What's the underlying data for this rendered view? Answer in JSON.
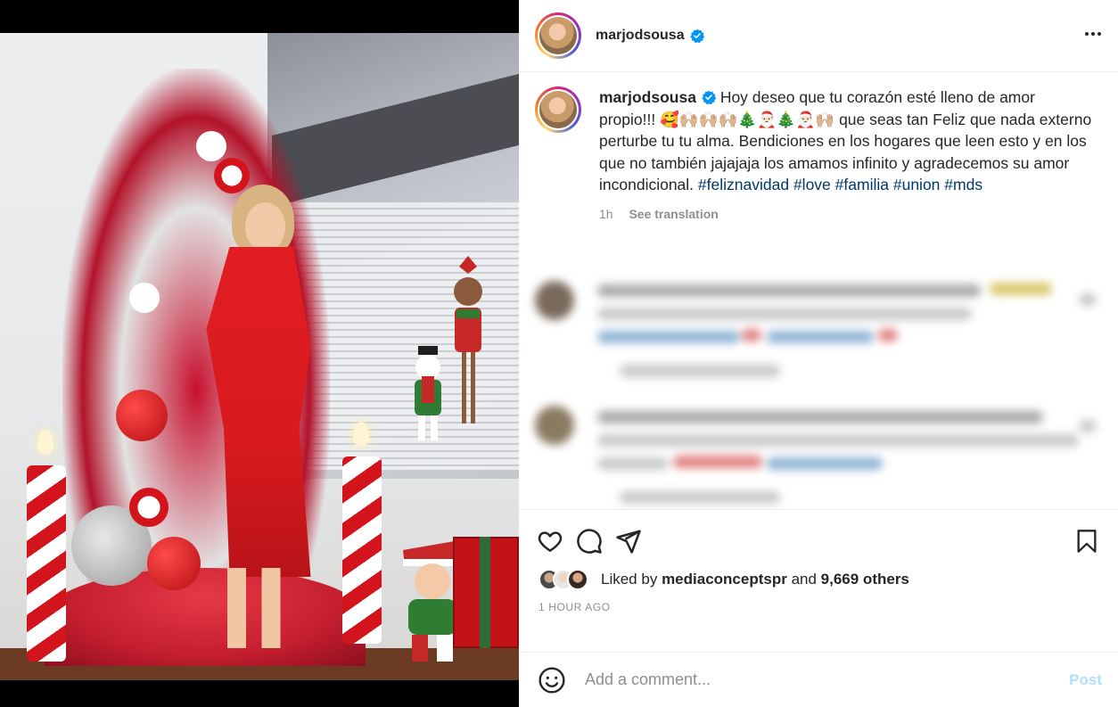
{
  "post": {
    "username": "marjodsousa",
    "verified": true,
    "more_icon": "more-horizontal-icon"
  },
  "caption": {
    "username": "marjodsousa",
    "text_part1": "Hoy deseo que tu corazón esté lleno de amor propio!!! 🥰🙌🏼🙌🏼🙌🏼🎄🎅🏻🎄🎅🏻🙌🏼 que seas tan Feliz que nada externo perturbe tu tu alma. Bendiciones en los hogares que leen esto y en los que no también jajajaja los amamos infinito y agradecemos su amor incondicional.",
    "hashtags": [
      "#feliznavidad",
      "#love",
      "#familia",
      "#union",
      "#mds"
    ],
    "time": "1h",
    "see_translation": "See translation"
  },
  "actions": {
    "like_icon": "heart-icon",
    "comment_icon": "comment-icon",
    "share_icon": "send-icon",
    "save_icon": "bookmark-icon"
  },
  "likes": {
    "prefix": "Liked by",
    "user": "mediaconceptspr",
    "connector": "and",
    "others": "9,669 others"
  },
  "timestamp": "1 HOUR AGO",
  "comment_box": {
    "placeholder": "Add a comment...",
    "post_label": "Post",
    "emoji_icon": "smiley-icon"
  },
  "colors": {
    "link": "#00376b",
    "muted": "#8e8e8e",
    "post_disabled": "#b2dffc",
    "verified": "#0095f6"
  }
}
